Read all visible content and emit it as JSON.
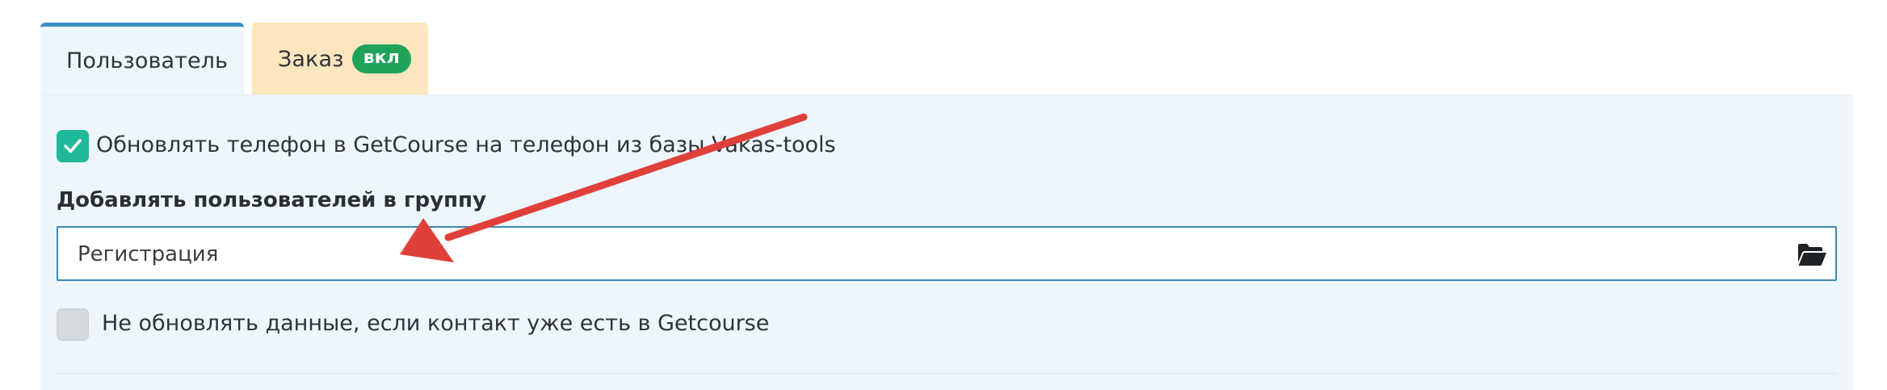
{
  "tabs": {
    "user_label": "Пользователь",
    "order_label": "Заказ",
    "order_badge": "вкл"
  },
  "settings": {
    "update_phone_label": "Обновлять телефон в GetCourse на телефон из базы Vakas-tools",
    "update_phone_checked": true,
    "group_label": "Добавлять пользователей в группу",
    "group_value": "Регистрация",
    "no_update_label": "Не обновлять данные, если контакт уже есть в Getcourse",
    "no_update_checked": false
  },
  "icons": {
    "check": "check-icon",
    "folder": "folder-open-icon",
    "annotation": "red-arrow"
  },
  "colors": {
    "tab_active_border": "#3b8ec2",
    "tab_order_bg": "#fde6bd",
    "badge_bg": "#1fa35b",
    "panel_bg": "#eef6fd",
    "checkbox_checked": "#1fb89a",
    "checkbox_unchecked": "#d5dadf",
    "field_border": "#3a89b5",
    "annotation_arrow": "#e0403a"
  }
}
